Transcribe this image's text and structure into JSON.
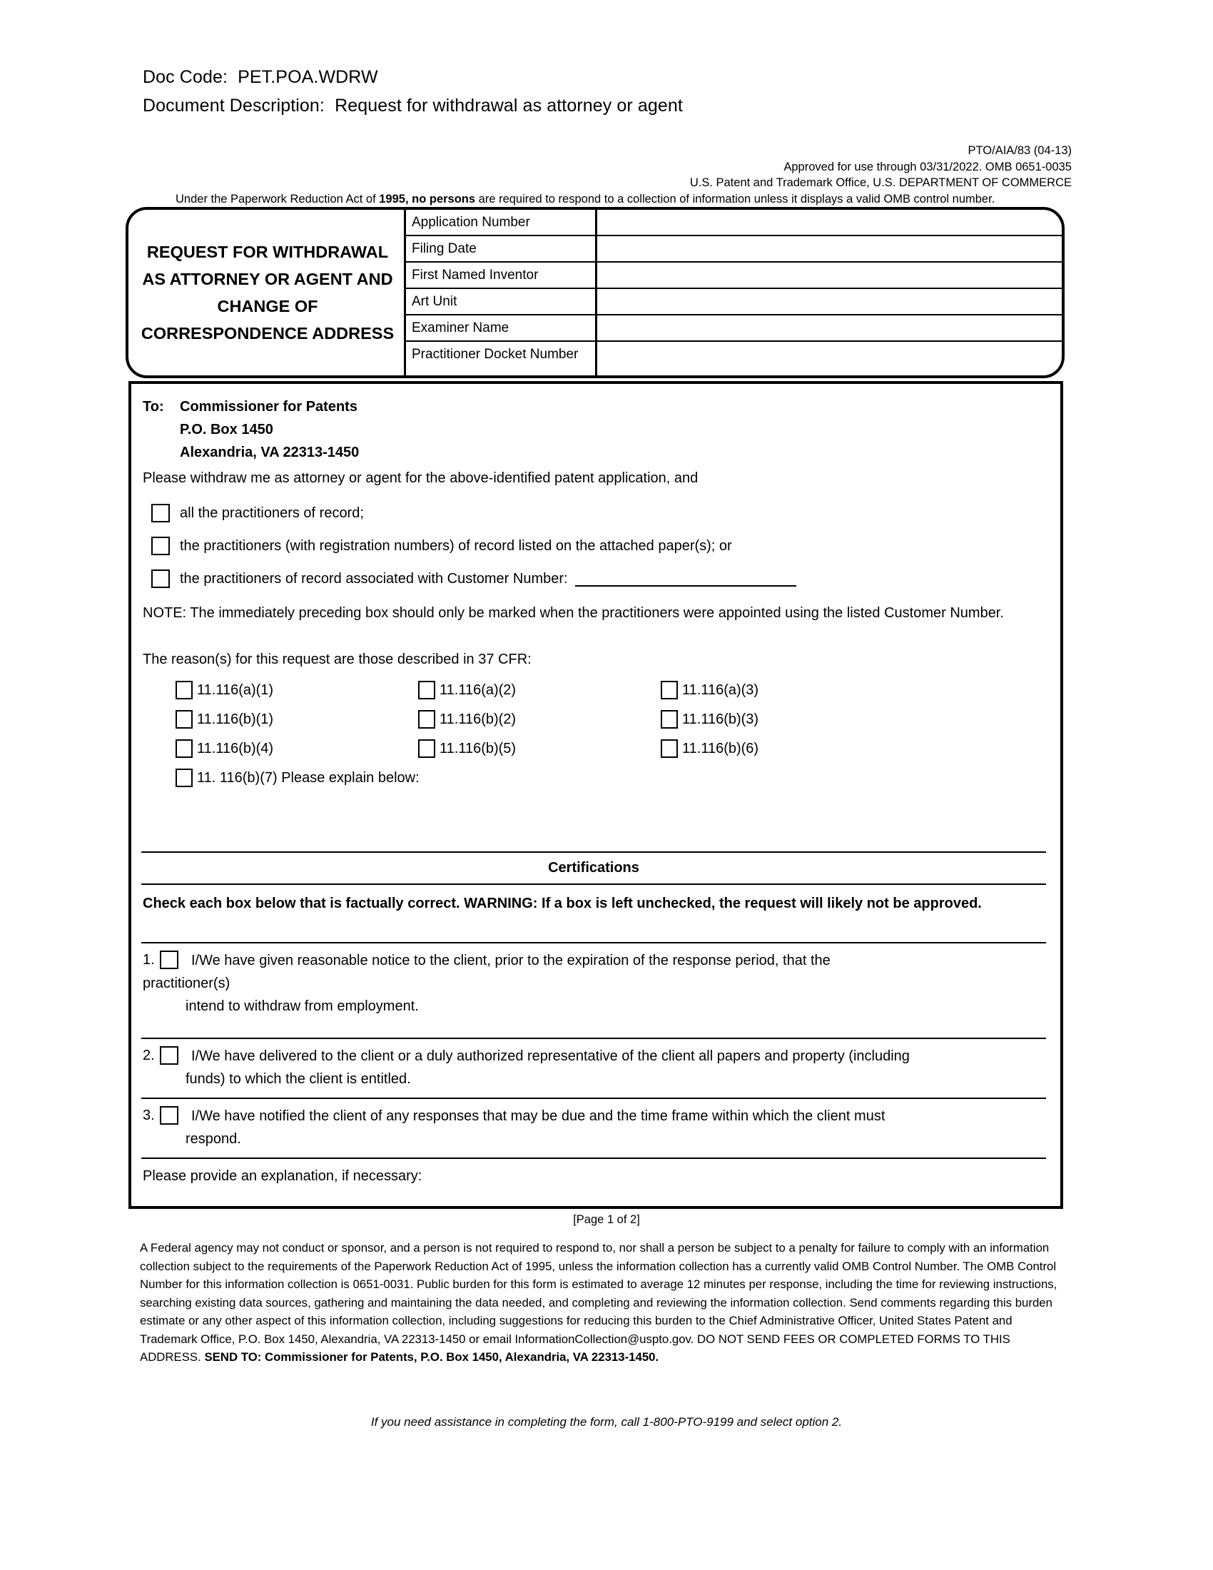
{
  "doc_header": {
    "doc_code_label": "Doc Code:  PET.POA.WDRW",
    "doc_description_label": "Document Description:  Request for withdrawal as attorney or agent"
  },
  "omb": {
    "form_number": "PTO/AIA/83 (04-13)",
    "approved_line": "Approved for use through 03/31/2022. OMB 0651-0035",
    "agency_line": "U.S. Patent and Trademark Office, U.S. DEPARTMENT OF COMMERCE",
    "pra_prefix": "Under the Paperwork Reduction Act of ",
    "pra_bold": "1995, no persons",
    "pra_suffix": " are required to respond to  a collection of information unless it displays a valid OMB control number."
  },
  "form_title": {
    "line1": "REQUEST FOR WITHDRAWAL",
    "line2": "AS ATTORNEY OR AGENT AND",
    "line3": "CHANGE OF",
    "line4": "CORRESPONDENCE ADDRESS"
  },
  "info_table": {
    "rows": [
      {
        "label": "Application Number",
        "value": ""
      },
      {
        "label": "Filing Date",
        "value": ""
      },
      {
        "label": "First Named Inventor",
        "value": ""
      },
      {
        "label": "Art Unit",
        "value": ""
      },
      {
        "label": "Examiner Name",
        "value": ""
      },
      {
        "label": "Practitioner Docket Number",
        "value": ""
      }
    ]
  },
  "addressee": {
    "to_label": "To:",
    "line1": "Commissioner for Patents",
    "line2": "P.O. Box 1450",
    "line3": "Alexandria, VA  22313-1450"
  },
  "request": {
    "intro": "Please withdraw me as attorney or agent for the above-identified patent application, and",
    "options": [
      "all the practitioners of record;",
      "the practitioners (with registration numbers) of record listed on the attached paper(s); or",
      "the practitioners of record associated with Customer Number:"
    ],
    "note": "NOTE:  The immediately preceding box should only be marked when the practitioners were appointed using the listed Customer Number."
  },
  "reasons": {
    "intro": "The reason(s) for this request are those described in 37 CFR:",
    "grid": [
      [
        "11.116(a)(1)",
        "11.116(a)(2)",
        "11.116(a)(3)"
      ],
      [
        "11.116(b)(1)",
        "11.116(b)(2)",
        "11.116(b)(3)"
      ],
      [
        "11.116(b)(4)",
        "11.116(b)(5)",
        "11.116(b)(6)"
      ]
    ],
    "explain_option": "11. 116(b)(7) Please explain below:"
  },
  "certifications": {
    "heading": "Certifications",
    "warning": "Check each box below that is factually correct. WARNING:  If a box is left unchecked, the request will likely not be approved.",
    "items": [
      {
        "number": "1.",
        "text_main": "I/We have given reasonable notice to the client, prior to the expiration of the response period, that the",
        "text_wrap": "practitioner(s)",
        "text_sub": "intend to withdraw from employment."
      },
      {
        "number": "2.",
        "text_main": "I/We have delivered to the client or a duly authorized representative of the client all papers and property (including",
        "text_sub": "funds) to which the client is entitled."
      },
      {
        "number": "3.",
        "text_main": "I/We have notified the client of any responses that may be due and the time frame within which the client must",
        "text_sub": "respond."
      }
    ],
    "explanation_label": "Please provide an explanation, if necessary:"
  },
  "footer": {
    "page_marker": "[Page 1 of 2]",
    "burden_text_1": "A Federal agency may not conduct or sponsor, and a person is not required to respond to, nor shall a person be subject to a penalty for failure to comply with an information collection subject to the requirements of the Paperwork Reduction Act of 1995, unless the information collection has a currently valid OMB Control Number. The OMB Control Number for this information collection is 0651-0031. Public burden for this form is estimated to average 12 minutes per response, including the time for reviewing instructions, searching existing data sources, gathering and maintaining the data needed, and completing and reviewing the information collection. Send comments regarding this burden estimate or any other aspect of this information collection, including suggestions for reducing this burden to the Chief Administrative Officer, United States Patent and Trademark Office, P.O. Box 1450, Alexandria, VA 22313-1450 or email InformationCollection@uspto.gov. DO NOT SEND FEES OR COMPLETED FORMS TO THIS ADDRESS. ",
    "burden_bold": "SEND TO:  Commissioner for Patents, P.O. Box 1450, Alexandria, VA 22313-1450.",
    "assistance": "If you need assistance in completing the form, call 1-800-PTO-9199 and select option 2."
  },
  "colors": {
    "ink": "#000000",
    "paper": "#ffffff"
  }
}
